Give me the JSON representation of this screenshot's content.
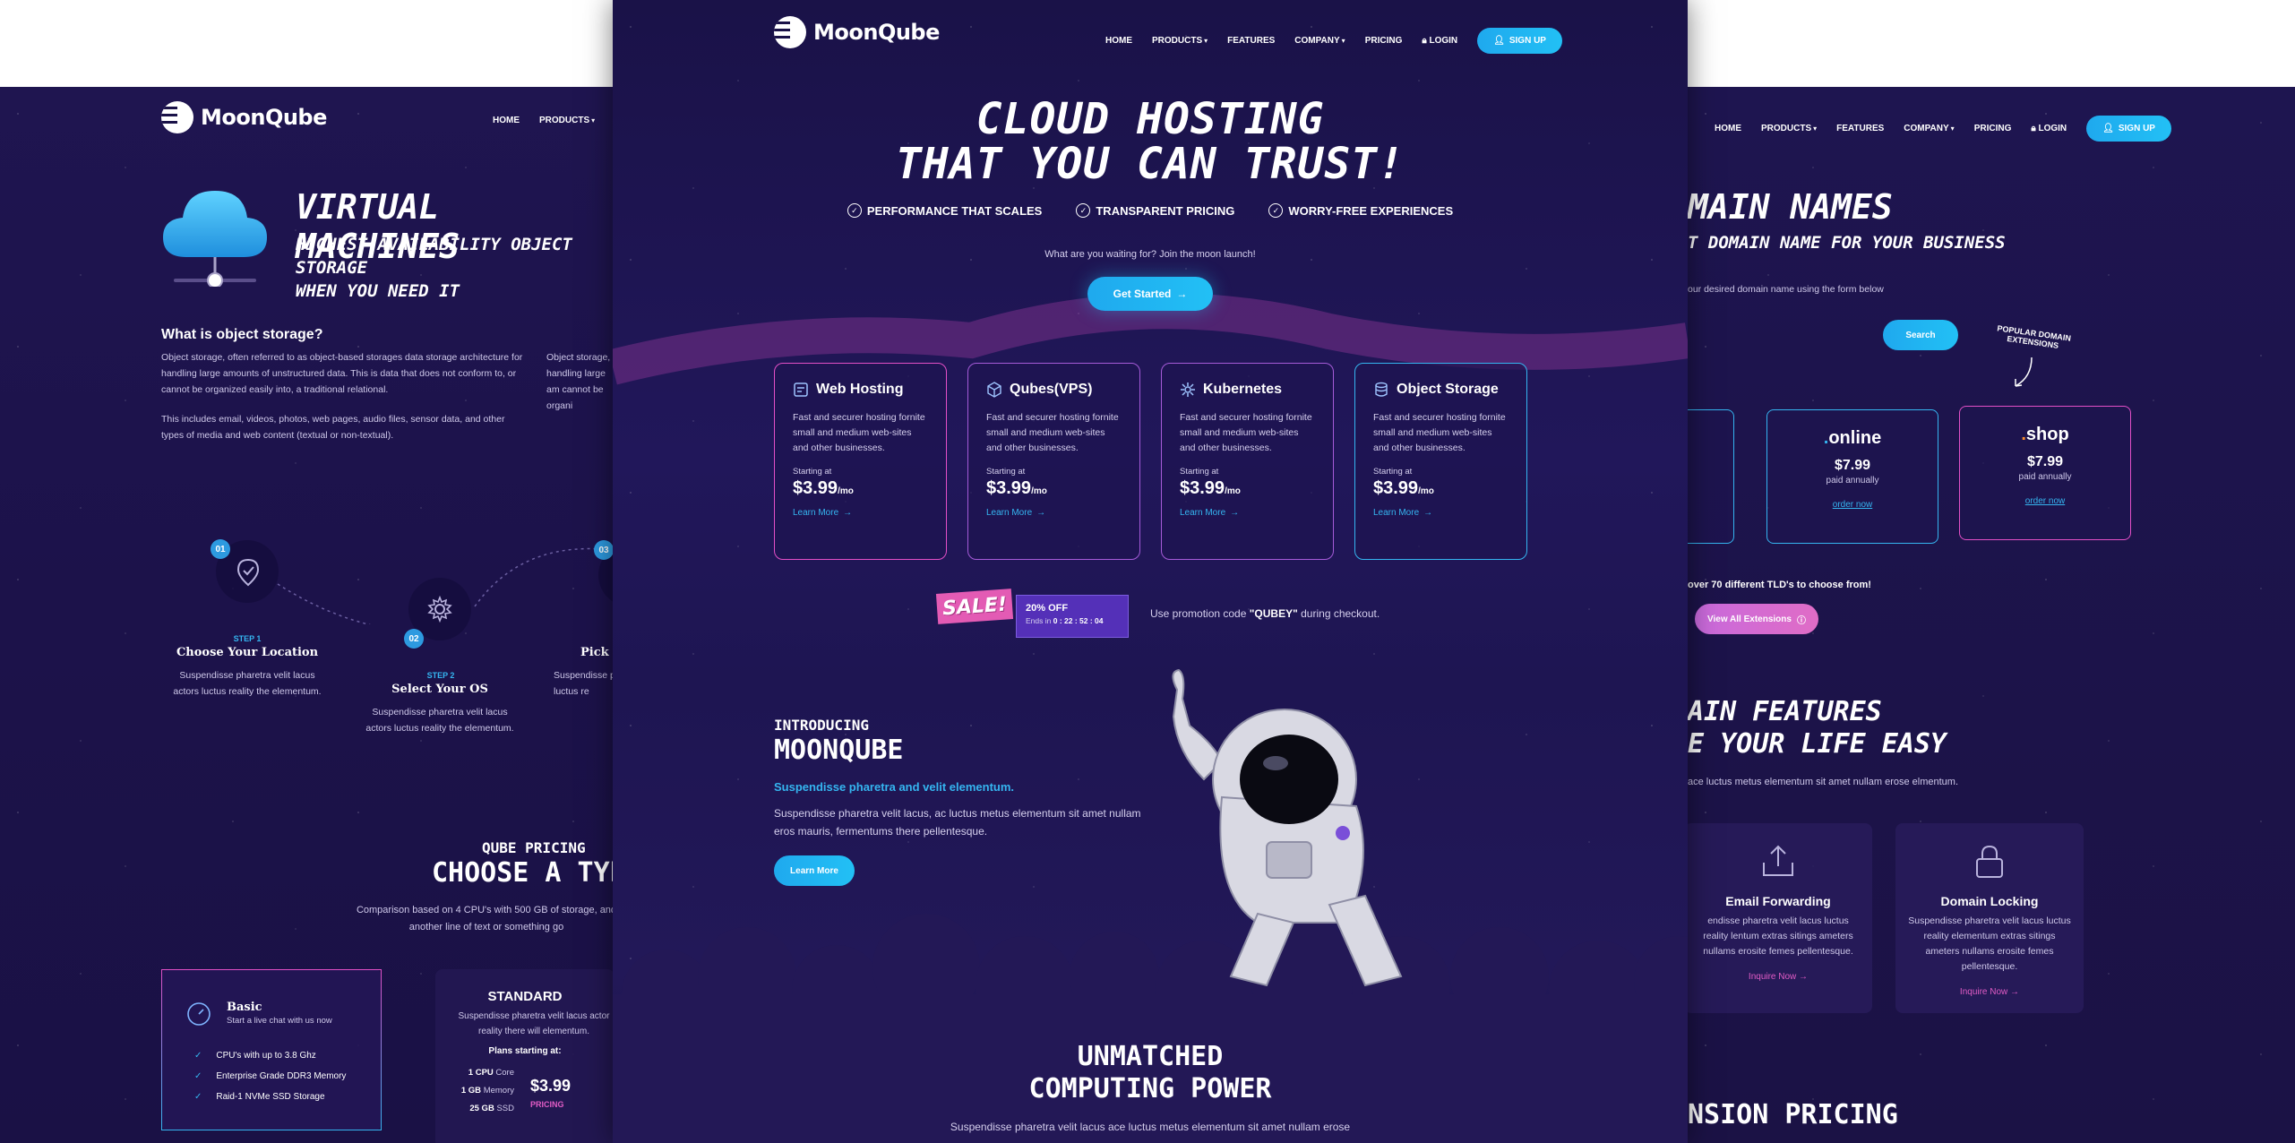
{
  "brand": "MoonQube",
  "nav": {
    "home": "HOME",
    "products": "PRODUCTS",
    "features": "FEATURES",
    "company": "COMPANY",
    "pricing": "PRICING",
    "login": "LOGIN",
    "signup": "SIGN UP"
  },
  "hero": {
    "title_line1": "CLOUD HOSTING",
    "title_line2": "THAT YOU CAN TRUST!",
    "checks": [
      "PERFORMANCE THAT SCALES",
      "TRANSPARENT PRICING",
      "WORRY-FREE EXPERIENCES"
    ],
    "tagline": "What are you waiting for? Join the moon launch!",
    "cta": "Get Started"
  },
  "cards": [
    {
      "title": "Web Hosting",
      "desc": "Fast and securer hosting fornite small and medium web-sites and other businesses.",
      "starting": "Starting at",
      "price": "$3.99",
      "per": "/mo",
      "link": "Learn More"
    },
    {
      "title": "Qubes(VPS)",
      "desc": "Fast and securer hosting fornite small and medium web-sites and other businesses.",
      "starting": "Starting at",
      "price": "$3.99",
      "per": "/mo",
      "link": "Learn More"
    },
    {
      "title": "Kubernetes",
      "desc": "Fast and securer hosting fornite small and medium web-sites and other businesses.",
      "starting": "Starting at",
      "price": "$3.99",
      "per": "/mo",
      "link": "Learn More"
    },
    {
      "title": "Object Storage",
      "desc": "Fast and securer hosting fornite small and medium web-sites and other businesses.",
      "starting": "Starting at",
      "price": "$3.99",
      "per": "/mo",
      "link": "Learn More"
    }
  ],
  "sale": {
    "tag": "SALE!",
    "percent": "20% OFF",
    "ends_label": "Ends in",
    "countdown": "0 : 22 : 52 : 04",
    "promo_prefix": "Use promotion code ",
    "promo_code": "\"QUBEY\"",
    "promo_suffix": " during checkout."
  },
  "intro": {
    "small": "INTRODUCING",
    "big": "MOONQUBE",
    "sub": "Suspendisse pharetra and velit elementum.",
    "text": "Suspendisse pharetra velit lacus, ac luctus metus elementum sit amet nullam eros mauris, fermentums there pellentesque.",
    "button": "Learn More"
  },
  "unmatched": {
    "line1": "UNMATCHED",
    "line2": "COMPUTING POWER",
    "text": "Suspendisse pharetra velit lacus ace luctus metus elementum sit amet nullam erose"
  },
  "left": {
    "title": "VIRTUAL MACHINES",
    "subtitle_line1": "HIGHEST AVAILABILITY OBJECT STORAGE",
    "subtitle_line2": "WHEN YOU NEED IT",
    "what_heading": "What is object storage?",
    "para1": "Object storage, often referred to as object-based storages data storage architecture for handling large amounts of unstructured data. This is data that does not conform to, or cannot be organized easily into, a traditional relational.",
    "para2": "This includes email, videos, photos, web pages, audio files, sensor data, and other types of media and web content (textual or non-textual).",
    "para_right": "Object storage, o handling large am cannot be organi",
    "steps": [
      {
        "num": "01",
        "label": "STEP 1",
        "title": "Choose Your Location",
        "desc": "Suspendisse pharetra velit lacus actors luctus reality the elementum."
      },
      {
        "num": "02",
        "label": "STEP 2",
        "title": "Select Your OS",
        "desc": "Suspendisse pharetra velit lacus actors luctus reality the elementum."
      },
      {
        "num": "03",
        "label": "",
        "title": "Pick Y",
        "desc": "Suspendisse p luctus re"
      }
    ],
    "qube_small": "QUBE PRICING",
    "qube_big": "CHOOSE A TYP",
    "qube_text": "Comparison based on 4 CPU's with 500 GB of storage, and another line of text or something go",
    "basic": {
      "name": "Basic",
      "tag": "Start a live chat with us now",
      "features": [
        "CPU's with up to 3.8 Ghz",
        "Enterprise Grade DDR3 Memory",
        "Raid-1 NVMe SSD Storage"
      ]
    },
    "standard": {
      "name": "STANDARD",
      "desc": "Suspendisse pharetra velit lacus actor reality there will elementum.",
      "plans_label": "Plans starting at:",
      "specs": [
        {
          "value": "1 CPU",
          "unit": "Core"
        },
        {
          "value": "1 GB",
          "unit": "Memory"
        },
        {
          "value": "25 GB",
          "unit": "SSD"
        }
      ],
      "price": "$3.99",
      "pricing_link": "PRICING"
    }
  },
  "right": {
    "title": "MAIN NAMES",
    "subtitle": "T DOMAIN NAME FOR YOUR BUSINESS",
    "hint": "our desired domain name using the form below",
    "search": "Search",
    "popular": "POPULAR DOMAIN EXTENSIONS",
    "tlds": [
      {
        "name": "online",
        "price": "$7.99",
        "per": "paid annually",
        "link": "order now"
      },
      {
        "name": "shop",
        "price": "$7.99",
        "per": "paid annually",
        "link": "order now"
      }
    ],
    "over_text": "over 70 different TLD's to choose from!",
    "view_all": "View All Extensions",
    "features_line1": "AIN FEATURES",
    "features_line2": "E YOUR LIFE EASY",
    "features_sub": "ace luctus metus elementum sit amet nullam erose elmentum.",
    "feature_cards": [
      {
        "title": "Email Forwarding",
        "desc": "endisse pharetra velit lacus luctus reality lentum extras sitings ameters nullams erosite femes pellentesque.",
        "link": "Inquire Now"
      },
      {
        "title": "Domain Locking",
        "desc": "Suspendisse pharetra velit lacus luctus reality elementum extras sitings ameters nullams erosite femes pellentesque.",
        "link": "Inquire Now"
      }
    ],
    "ext_pricing": "NSION PRICING"
  },
  "colors": {
    "accent_cyan": "#22c0f5",
    "accent_pink": "#e24fc6",
    "bg_dark": "#1c1349"
  }
}
